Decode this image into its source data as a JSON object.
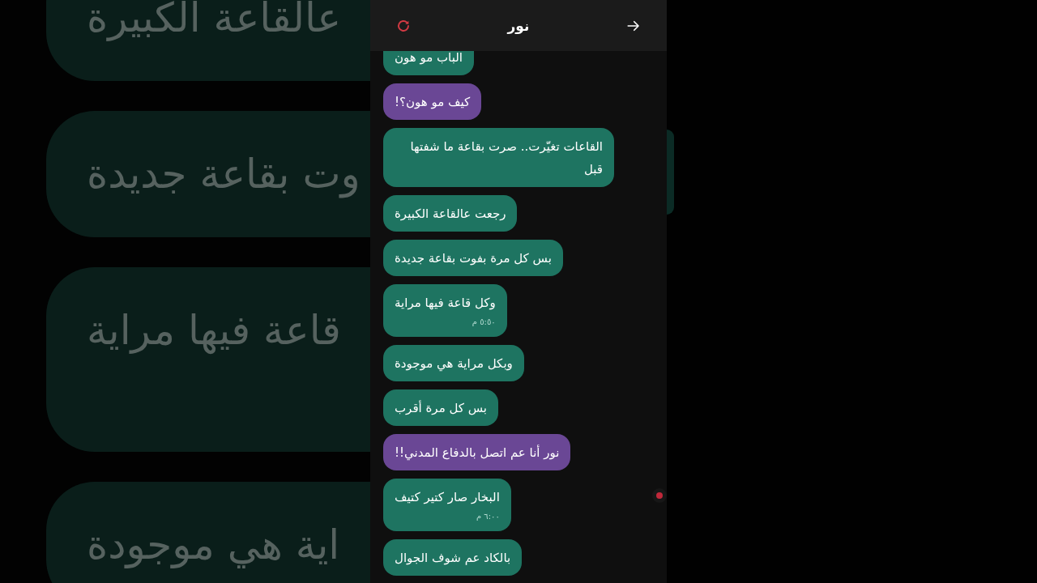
{
  "header": {
    "title": "نور"
  },
  "messages": [
    {
      "text": "الباب مو هون",
      "color": "#1e7461"
    },
    {
      "text": "كيف مو هون؟!",
      "color": "#6a4795"
    },
    {
      "text": "القاعات تغيّرت.. صرت بقاعة ما شفتها قبل",
      "color": "#1e7461"
    },
    {
      "text": "رجعت عالقاعة الكبيرة",
      "color": "#1e7461"
    },
    {
      "text": "بس كل مرة بفوت بقاعة جديدة",
      "color": "#1e7461"
    },
    {
      "text": "وكل قاعة فيها مراية",
      "color": "#1e7461",
      "time": "٥:٥٠ م"
    },
    {
      "text": "وبكل مراية هي موجودة",
      "color": "#1e7461"
    },
    {
      "text": "بس كل مرة أقرب",
      "color": "#1e7461"
    },
    {
      "text": "نور أنا عم اتصل بالدفاع المدني!!",
      "color": "#6a4795"
    },
    {
      "text": "البخار صار كتير كتيف",
      "color": "#1e7461",
      "time": "٦:٠٠ م"
    },
    {
      "text": "بالكاد عم شوف الجوال",
      "color": "#1e7461"
    }
  ],
  "background_bubbles": [
    {
      "text": "عالقاعة الكبيرة"
    },
    {
      "text": "وت بقاعة جديدة"
    },
    {
      "text": "قاعة فيها مراية"
    },
    {
      "text": "اية هي موجودة"
    }
  ]
}
